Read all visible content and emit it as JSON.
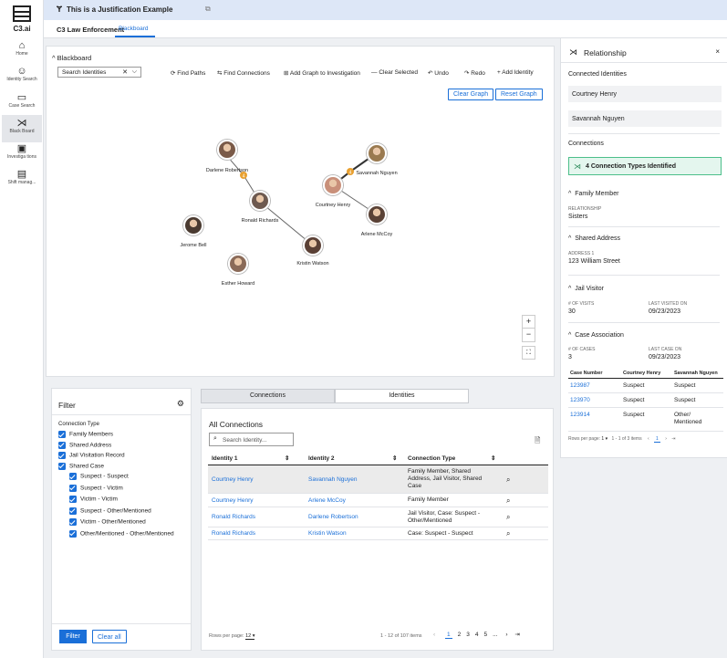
{
  "app": {
    "logo_text": "C3.ai",
    "title": "This is a Justification Example"
  },
  "leftnav": [
    {
      "label": "Home",
      "icon": "home-icon"
    },
    {
      "label": "Identity Search",
      "icon": "person-icon"
    },
    {
      "label": "Case Search",
      "icon": "briefcase-icon"
    },
    {
      "label": "Black Board",
      "icon": "network-icon",
      "active": true
    },
    {
      "label": "Investiga tions",
      "icon": "folder-icon"
    },
    {
      "label": "Shift manag...",
      "icon": "clipboard-icon"
    }
  ],
  "header": {
    "section": "C3 Law Enforcement",
    "tab": "Blackboard"
  },
  "blackboard": {
    "title": "Blackboard",
    "search_placeholder": "Search Identities",
    "toolbar": {
      "find_paths": "Find Paths",
      "find_connections": "Find Connections",
      "add_graph": "Add Graph to Investigation",
      "clear_selected": "Clear Selected",
      "undo": "Undo",
      "redo": "Redo",
      "add_identity": "Add Identity"
    },
    "clear_graph": "Clear Graph",
    "reset_graph": "Reset Graph",
    "nodes": [
      {
        "name": "Darlene Robertson",
        "color": "#7a5a48"
      },
      {
        "name": "Ronald Richards",
        "color": "#6e5a50"
      },
      {
        "name": "Jerome Bell",
        "color": "#4a3a30"
      },
      {
        "name": "Kristin Watson",
        "color": "#5a4035"
      },
      {
        "name": "Esther Howard",
        "color": "#8a6a58"
      },
      {
        "name": "Savannah Nguyen",
        "color": "#9a7a50"
      },
      {
        "name": "Courtney Henry",
        "color": "#c9907a"
      },
      {
        "name": "Arlene McCoy",
        "color": "#5a4236"
      }
    ],
    "badge_count": "4",
    "zoom_in": "+",
    "zoom_out": "−"
  },
  "filter": {
    "title": "Filter",
    "group_label": "Connection Type",
    "items": [
      "Family Members",
      "Shared Address",
      "Jail Visitation Record",
      "Shared Case"
    ],
    "sub_items": [
      "Suspect - Suspect",
      "Suspect - Victim",
      "Victim - Victim",
      "Suspect - Other/Mentioned",
      "Victim - Other/Mentioned",
      "Other/Mentioned - Other/Mentioned"
    ],
    "filter_button": "Filter",
    "clear_button": "Clear all"
  },
  "connections": {
    "tabs": [
      "Connections",
      "Identities"
    ],
    "title": "All Connections",
    "search_placeholder": "Search Identity...",
    "columns": [
      "Identity 1",
      "Identity 2",
      "Connection Type"
    ],
    "rows": [
      {
        "id1": "Courtney Henry",
        "id2": "Savannah Nguyen",
        "type": "Family Member, Shared Address, Jail Visitor, Shared Case"
      },
      {
        "id1": "Courtney Henry",
        "id2": "Arlene McCoy",
        "type": "Family Member"
      },
      {
        "id1": "Ronald Richards",
        "id2": "Darlene Robertson",
        "type": "Jail Visitor, Case: Suspect - Other/Mentioned"
      },
      {
        "id1": "Ronald Richards",
        "id2": "Kristin Watson",
        "type": "Case: Suspect - Suspect"
      }
    ],
    "rows_per_page_label": "Rows per page:",
    "rows_per_page": "12",
    "range": "1 - 12 of 107 items",
    "pages": [
      "1",
      "2",
      "3",
      "4",
      "5",
      "..."
    ]
  },
  "relationship": {
    "title": "Relationship",
    "connected_label": "Connected Identities",
    "identities": [
      "Courtney Henry",
      "Savannah Nguyen"
    ],
    "connections_label": "Connections",
    "types_banner": "4 Connection Types Identified",
    "family": {
      "title": "Family Member",
      "label": "RELATIONSHIP",
      "value": "Sisters"
    },
    "address": {
      "title": "Shared Address",
      "label": "ADDRESS 1",
      "value": "123 William Street"
    },
    "jail": {
      "title": "Jail Visitor",
      "visits_label": "# OF VISITS",
      "visits": "30",
      "last_label": "LAST VISITED ON",
      "last": "09/23/2023"
    },
    "case": {
      "title": "Case Association",
      "cases_label": "# OF CASES",
      "cases": "3",
      "last_label": "LAST CASE ON",
      "last": "09/23/2023",
      "columns": [
        "Case Number",
        "Courtney Henry",
        "Savannah Nguyen"
      ],
      "rows": [
        {
          "num": "123987",
          "a": "Suspect",
          "b": "Suspect"
        },
        {
          "num": "123970",
          "a": "Suspect",
          "b": "Suspect"
        },
        {
          "num": "123914",
          "a": "Suspect",
          "b": "Other/ Mentioned"
        }
      ],
      "rows_per_page_label": "Rows per page:",
      "rows_per_page": "1",
      "range": "1 - 1 of 3 items",
      "page": "1"
    }
  },
  "colors": {
    "accent": "#1a6fd8",
    "edge_badge": "#e8a030",
    "banner_bg": "#e4f6ee",
    "banner_border": "#4cbf8a"
  }
}
